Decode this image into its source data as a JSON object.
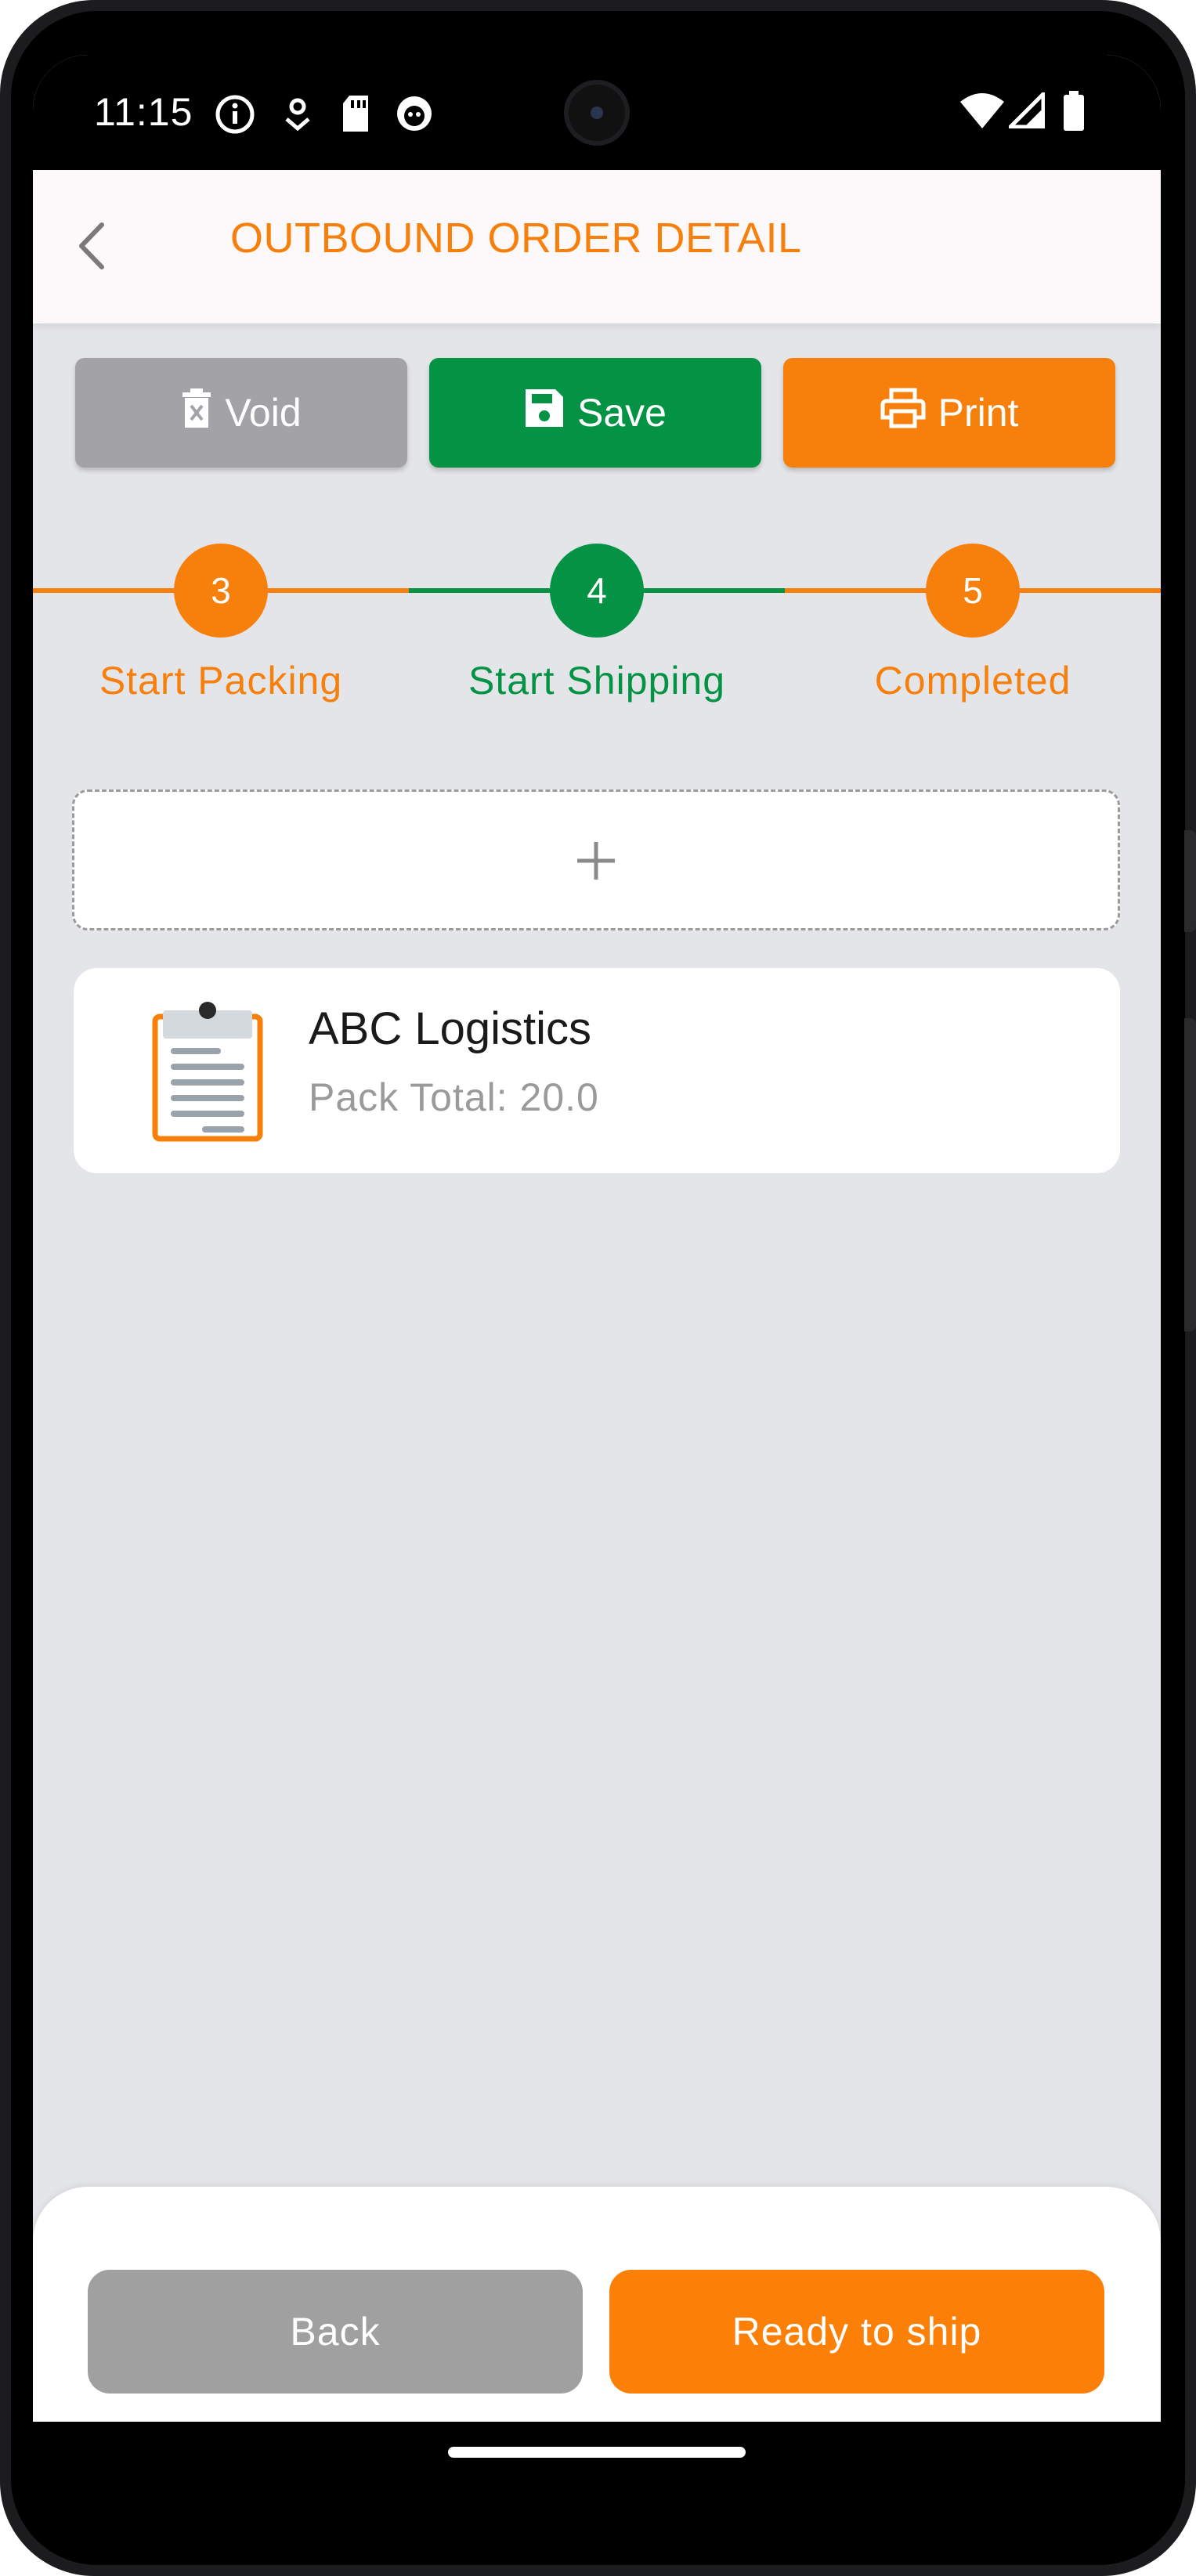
{
  "status_bar": {
    "time": "11:15"
  },
  "header": {
    "title": "OUTBOUND ORDER DETAIL"
  },
  "actions": {
    "void_label": "Void",
    "save_label": "Save",
    "print_label": "Print"
  },
  "stepper": {
    "steps": [
      {
        "number": "3",
        "label": "Start Packing",
        "color": "#f77f0b"
      },
      {
        "number": "4",
        "label": "Start Shipping",
        "color": "#049345"
      },
      {
        "number": "5",
        "label": "Completed",
        "color": "#f77f0b"
      }
    ],
    "current_step": "4"
  },
  "card": {
    "name": "ABC Logistics",
    "pack_total": "Pack Total: 20.0"
  },
  "footer": {
    "back_label": "Back",
    "ship_label": "Ready to ship"
  },
  "colors": {
    "accent": "#f77f0b",
    "success": "#049345",
    "neutral": "#a3a3a7"
  },
  "icons": {
    "status": [
      "info-icon",
      "location-pin-icon",
      "sd-card-icon",
      "cat-face-icon",
      "wifi-icon",
      "signal-icon",
      "battery-icon"
    ],
    "header": "back-arrow-icon",
    "actions": [
      "trash-icon",
      "floppy-disk-icon",
      "printer-icon"
    ],
    "add": "plus-icon",
    "card": "clipboard-icon"
  }
}
